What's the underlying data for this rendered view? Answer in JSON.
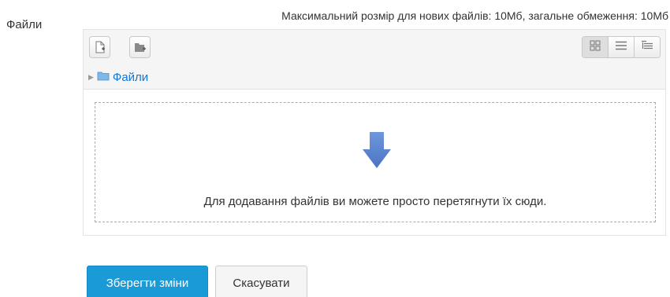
{
  "field": {
    "label": "Файли",
    "limits_text": "Максимальний розмір для нових файлів: 10Мб, загальне обмеження: 10Мб"
  },
  "filemanager": {
    "toolbar": {
      "add_file_icon": "add-file-icon",
      "create_folder_icon": "create-folder-icon",
      "view_modes": [
        {
          "icon": "icons-view-icon",
          "active": true
        },
        {
          "icon": "list-view-icon",
          "active": false
        },
        {
          "icon": "tree-view-icon",
          "active": false
        }
      ]
    },
    "path": {
      "folder_label": "Файли"
    },
    "dropzone": {
      "icon": "down-arrow-icon",
      "text": "Для додавання файлів ви можете просто перетягнути їх сюди."
    }
  },
  "buttons": {
    "save_label": "Зберегти зміни",
    "cancel_label": "Скасувати"
  },
  "colors": {
    "primary": "#1b9ad8",
    "link": "#1177d1",
    "arrow": "#5b83cf"
  }
}
